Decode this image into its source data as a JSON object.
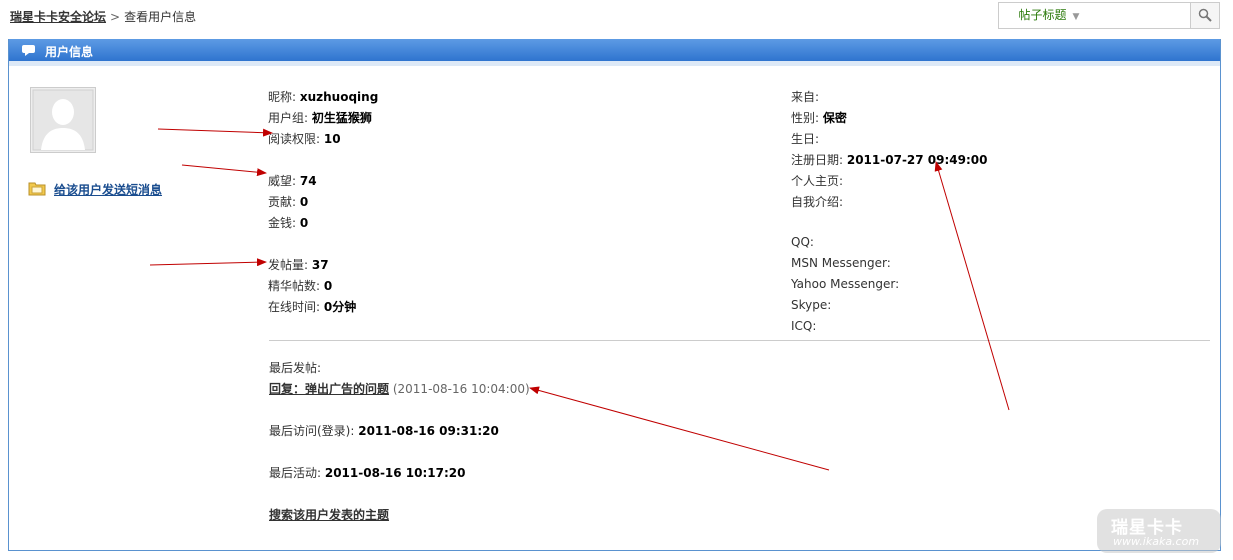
{
  "breadcrumb": {
    "home": "瑞星卡卡安全论坛",
    "sep": ">",
    "current": "查看用户信息"
  },
  "search": {
    "scope": "帖子标题"
  },
  "panel": {
    "title": "用户信息"
  },
  "send_pm": "给该用户发送短消息",
  "left": [
    {
      "label": "昵称: ",
      "value": "xuzhuoqing"
    },
    {
      "label": "用户组: ",
      "value": "初生猛猴狮"
    },
    {
      "label": "阅读权限: ",
      "value": "10"
    },
    {
      "label": "威望: ",
      "value": "74"
    },
    {
      "label": "贡献: ",
      "value": "0"
    },
    {
      "label": "金钱: ",
      "value": "0"
    },
    {
      "label": "发帖量: ",
      "value": "37"
    },
    {
      "label": "精华帖数: ",
      "value": "0"
    },
    {
      "label": "在线时间: ",
      "value": "0分钟"
    }
  ],
  "right": [
    {
      "label": "来自:",
      "value": ""
    },
    {
      "label": "性别: ",
      "value": "保密"
    },
    {
      "label": "生日:",
      "value": ""
    },
    {
      "label": "注册日期: ",
      "value": "2011-07-27 09:49:00"
    },
    {
      "label": "个人主页:",
      "value": ""
    },
    {
      "label": "自我介绍:",
      "value": ""
    },
    {
      "label": "QQ:",
      "value": ""
    },
    {
      "label": "MSN Messenger:",
      "value": ""
    },
    {
      "label": "Yahoo Messenger:",
      "value": ""
    },
    {
      "label": "Skype:",
      "value": ""
    },
    {
      "label": "ICQ:",
      "value": ""
    }
  ],
  "last_post": {
    "label": "最后发帖:",
    "link": "回复：弹出广告的问题",
    "time": "(2011-08-16 10:04:00)"
  },
  "last_visit": {
    "label": "最后访问(登录): ",
    "value": "2011-08-16 09:31:20"
  },
  "last_active": {
    "label": "最后活动: ",
    "value": "2011-08-16 10:17:20"
  },
  "search_topics": "搜索该用户发表的主题",
  "watermark": {
    "brand": "瑞星卡卡",
    "url": "www.ikaka.com"
  },
  "colors": {
    "header": "#2f74cf",
    "link": "#1a4d8f",
    "arrow": "#c00000",
    "scope": "#2b7a0b"
  }
}
